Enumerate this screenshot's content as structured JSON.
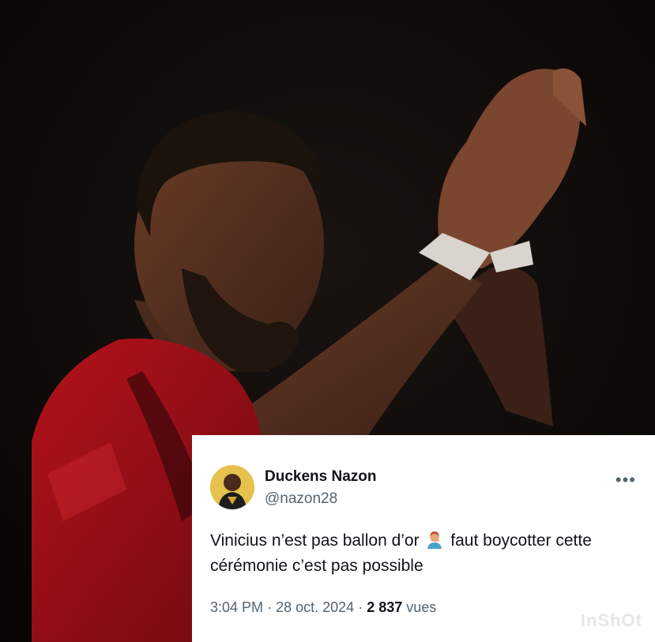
{
  "post": {
    "display_name": "Duckens Nazon",
    "handle": "@nazon28",
    "more_icon": "more-horizontal-icon",
    "text_before_emoji": "Vinicius n’est pas ballon d’or",
    "emoji": "person-facepalming-emoji",
    "text_after_emoji": "faut boycotter cette cérémonie c’est pas possible",
    "time": "3:04 PM",
    "date": "28 oct. 2024",
    "separator": "·",
    "views_count": "2 837",
    "views_label": "vues"
  },
  "watermark": "InShOt",
  "colors": {
    "jersey_red": "#b5121b",
    "background": "#0b0907",
    "card_bg": "#ffffff",
    "secondary_text": "#536471"
  }
}
